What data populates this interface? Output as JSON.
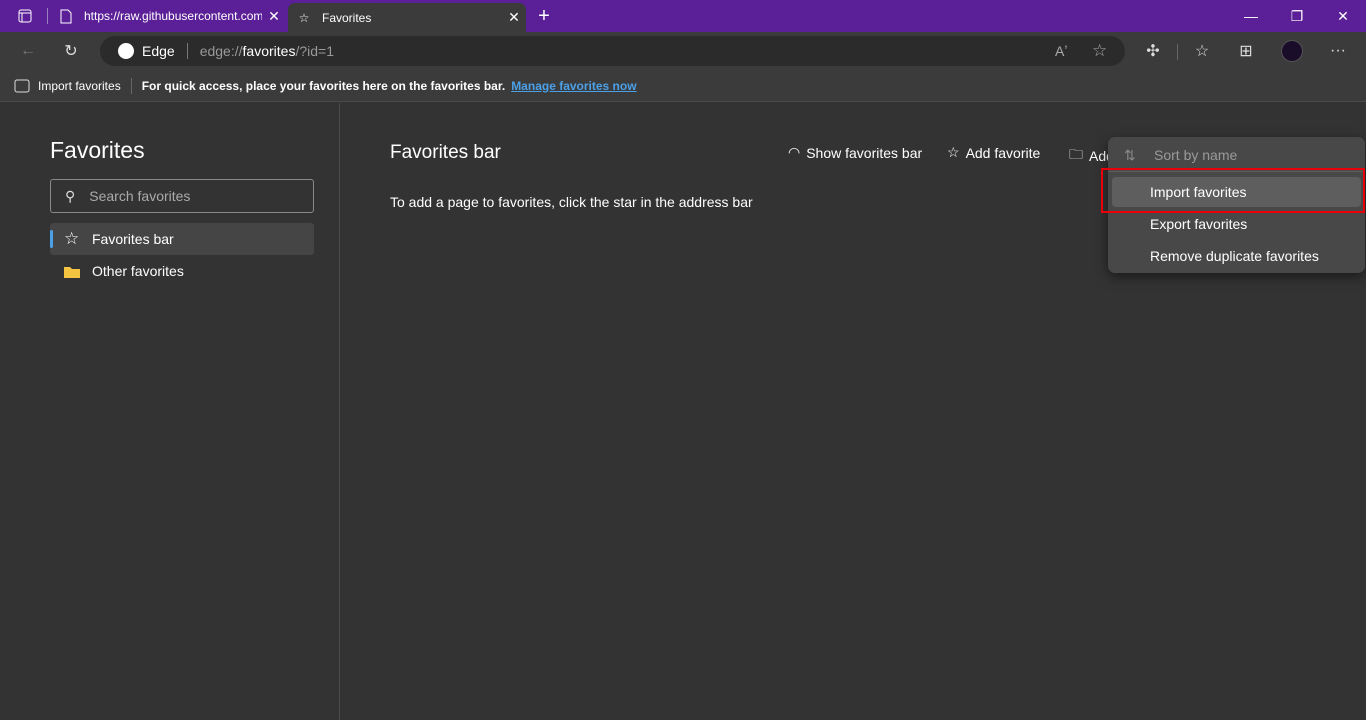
{
  "tabs": [
    {
      "label": "https://raw.githubusercontent.com",
      "icon": "page-icon"
    },
    {
      "label": "Favorites",
      "icon": "favorites-icon",
      "active": true
    }
  ],
  "address": {
    "site_label": "Edge",
    "url_prefix": "edge://",
    "url_host": "favorites",
    "url_rest": "/?id=1"
  },
  "favorites_bar": {
    "import_label": "Import favorites",
    "message": "For quick access, place your favorites here on the favorites bar.",
    "manage_link": "Manage favorites now"
  },
  "sidebar": {
    "title": "Favorites",
    "search_placeholder": "Search favorites",
    "items": [
      {
        "label": "Favorites bar",
        "selected": true
      },
      {
        "label": "Other favorites"
      }
    ]
  },
  "main": {
    "title": "Favorites bar",
    "hint": "To add a page to favorites, click the star in the address bar",
    "actions": {
      "show_bar": "Show favorites bar",
      "add_favorite": "Add favorite",
      "add_folder": "Add folder"
    }
  },
  "menu": {
    "items": [
      {
        "label": "Sort by name",
        "disabled": true
      },
      {
        "label": "Import favorites",
        "highlighted": true
      },
      {
        "label": "Export favorites"
      },
      {
        "label": "Remove duplicate favorites"
      }
    ]
  },
  "colors": {
    "titlebar": "#5b1f97",
    "highlight_box": "#e8000b",
    "link": "#4ba0e8"
  }
}
